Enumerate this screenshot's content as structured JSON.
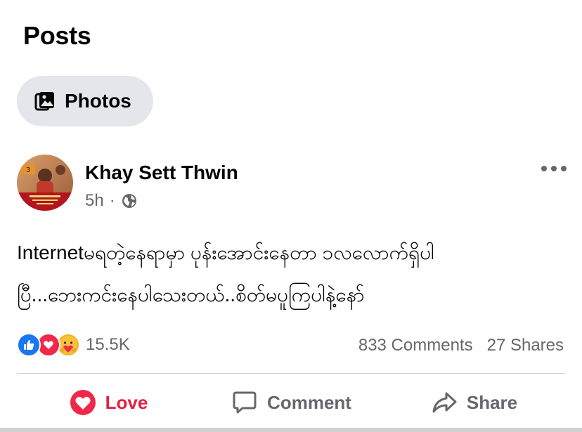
{
  "section": {
    "title": "Posts"
  },
  "filter_chip": {
    "label": "Photos",
    "icon": "photos-icon"
  },
  "post": {
    "author": "Khay Sett Thwin",
    "time": "5h",
    "separator": "·",
    "visibility_icon": "globe-icon",
    "text_line1": "Internetမရတဲ့နေရာမှာ ပုန်းအောင်းနေတာ ၁လလောက်ရှိပါ",
    "text_line2": "ပြီ...ဘေးကင်းနေပါသေးတယ်..စိတ်မပူကြပါနဲ့နော်",
    "reactions": {
      "types": [
        "like",
        "love",
        "care"
      ],
      "count": "15.5K"
    },
    "comments": "833 Comments",
    "shares": "27 Shares"
  },
  "actions": {
    "love": "Love",
    "comment": "Comment",
    "share": "Share"
  },
  "colors": {
    "love_red": "#e41e3f",
    "like_blue": "#1877f2",
    "secondary_text": "#65676b",
    "chip_bg": "#e4e6eb"
  }
}
